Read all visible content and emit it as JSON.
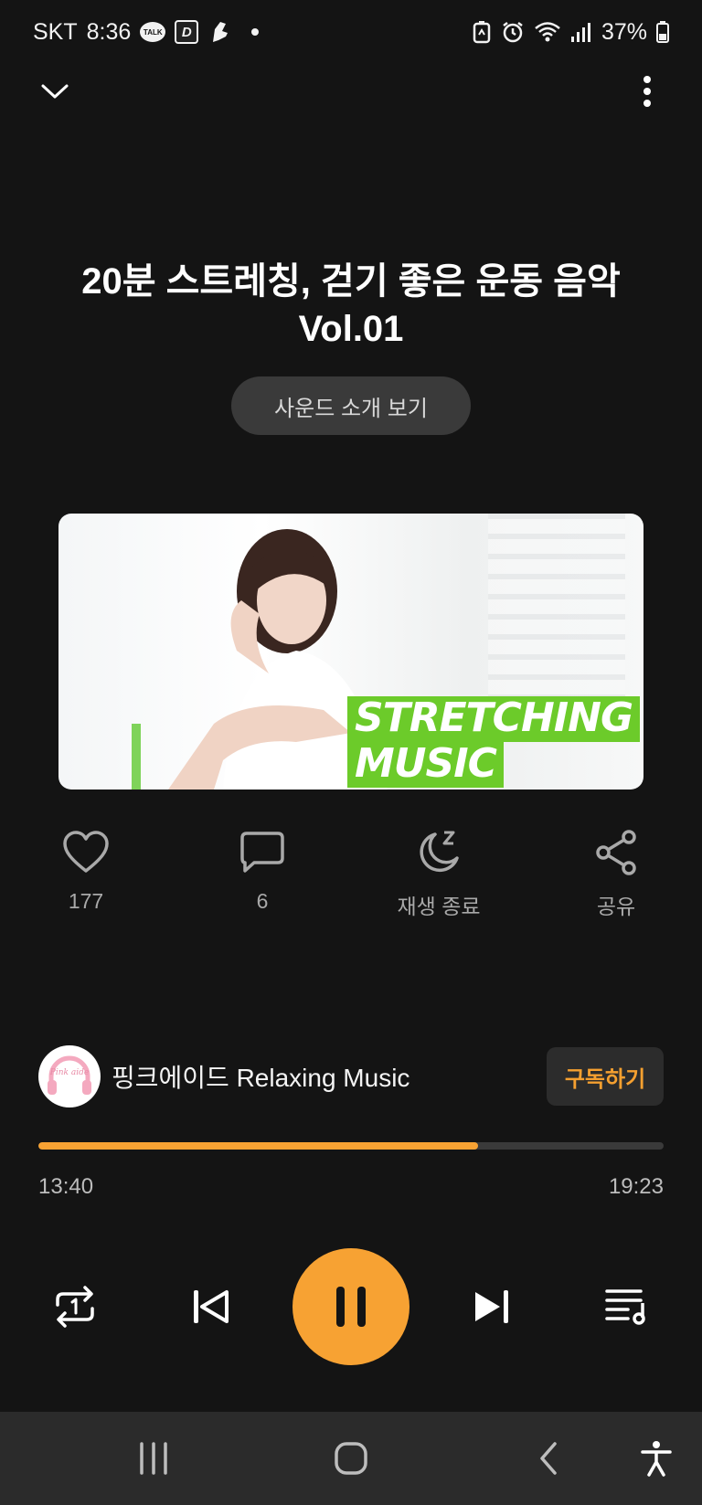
{
  "status_bar": {
    "carrier": "SKT",
    "time": "8:36",
    "talk_label": "TALK",
    "d_badge": "D",
    "battery": "37%",
    "icons": [
      "kakaotalk-icon",
      "d-app-icon",
      "shoe-icon",
      "battery-saver-icon",
      "alarm-icon",
      "wifi-icon",
      "signal-icon",
      "battery-icon"
    ]
  },
  "top_bar": {
    "collapse_icon": "chevron-down-icon",
    "more_icon": "more-vertical-icon"
  },
  "track": {
    "title_line1": "20분 스트레칭, 걷기 좋은 운동 음악",
    "title_line2": "Vol.01",
    "intro_button": "사운드 소개 보기",
    "thumbnail_text_line1": "STRETCHING",
    "thumbnail_text_line2": "MUSIC"
  },
  "actions": {
    "like": {
      "icon": "heart-icon",
      "label": "177"
    },
    "comment": {
      "icon": "comment-icon",
      "label": "6"
    },
    "sleep_timer": {
      "icon": "moon-sleep-icon",
      "label": "재생 종료"
    },
    "share": {
      "icon": "share-icon",
      "label": "공유"
    }
  },
  "channel": {
    "name": "핑크에이드 Relaxing Music",
    "avatar_text": "Pink aide",
    "subscribe_label": "구독하기"
  },
  "player": {
    "progress_fraction": 0.703,
    "current_time": "13:40",
    "total_time": "19:23",
    "repeat_icon": "repeat-one-icon",
    "prev_icon": "skip-previous-icon",
    "play_pause_icon": "pause-icon",
    "next_icon": "skip-next-icon",
    "playlist_icon": "playlist-icon"
  },
  "colors": {
    "accent": "#f7a233",
    "background": "#141414",
    "thumbnail_badge": "#6ccb2a"
  },
  "nav_bar": {
    "icons": [
      "recent-apps-icon",
      "home-icon",
      "back-icon",
      "accessibility-icon"
    ]
  }
}
